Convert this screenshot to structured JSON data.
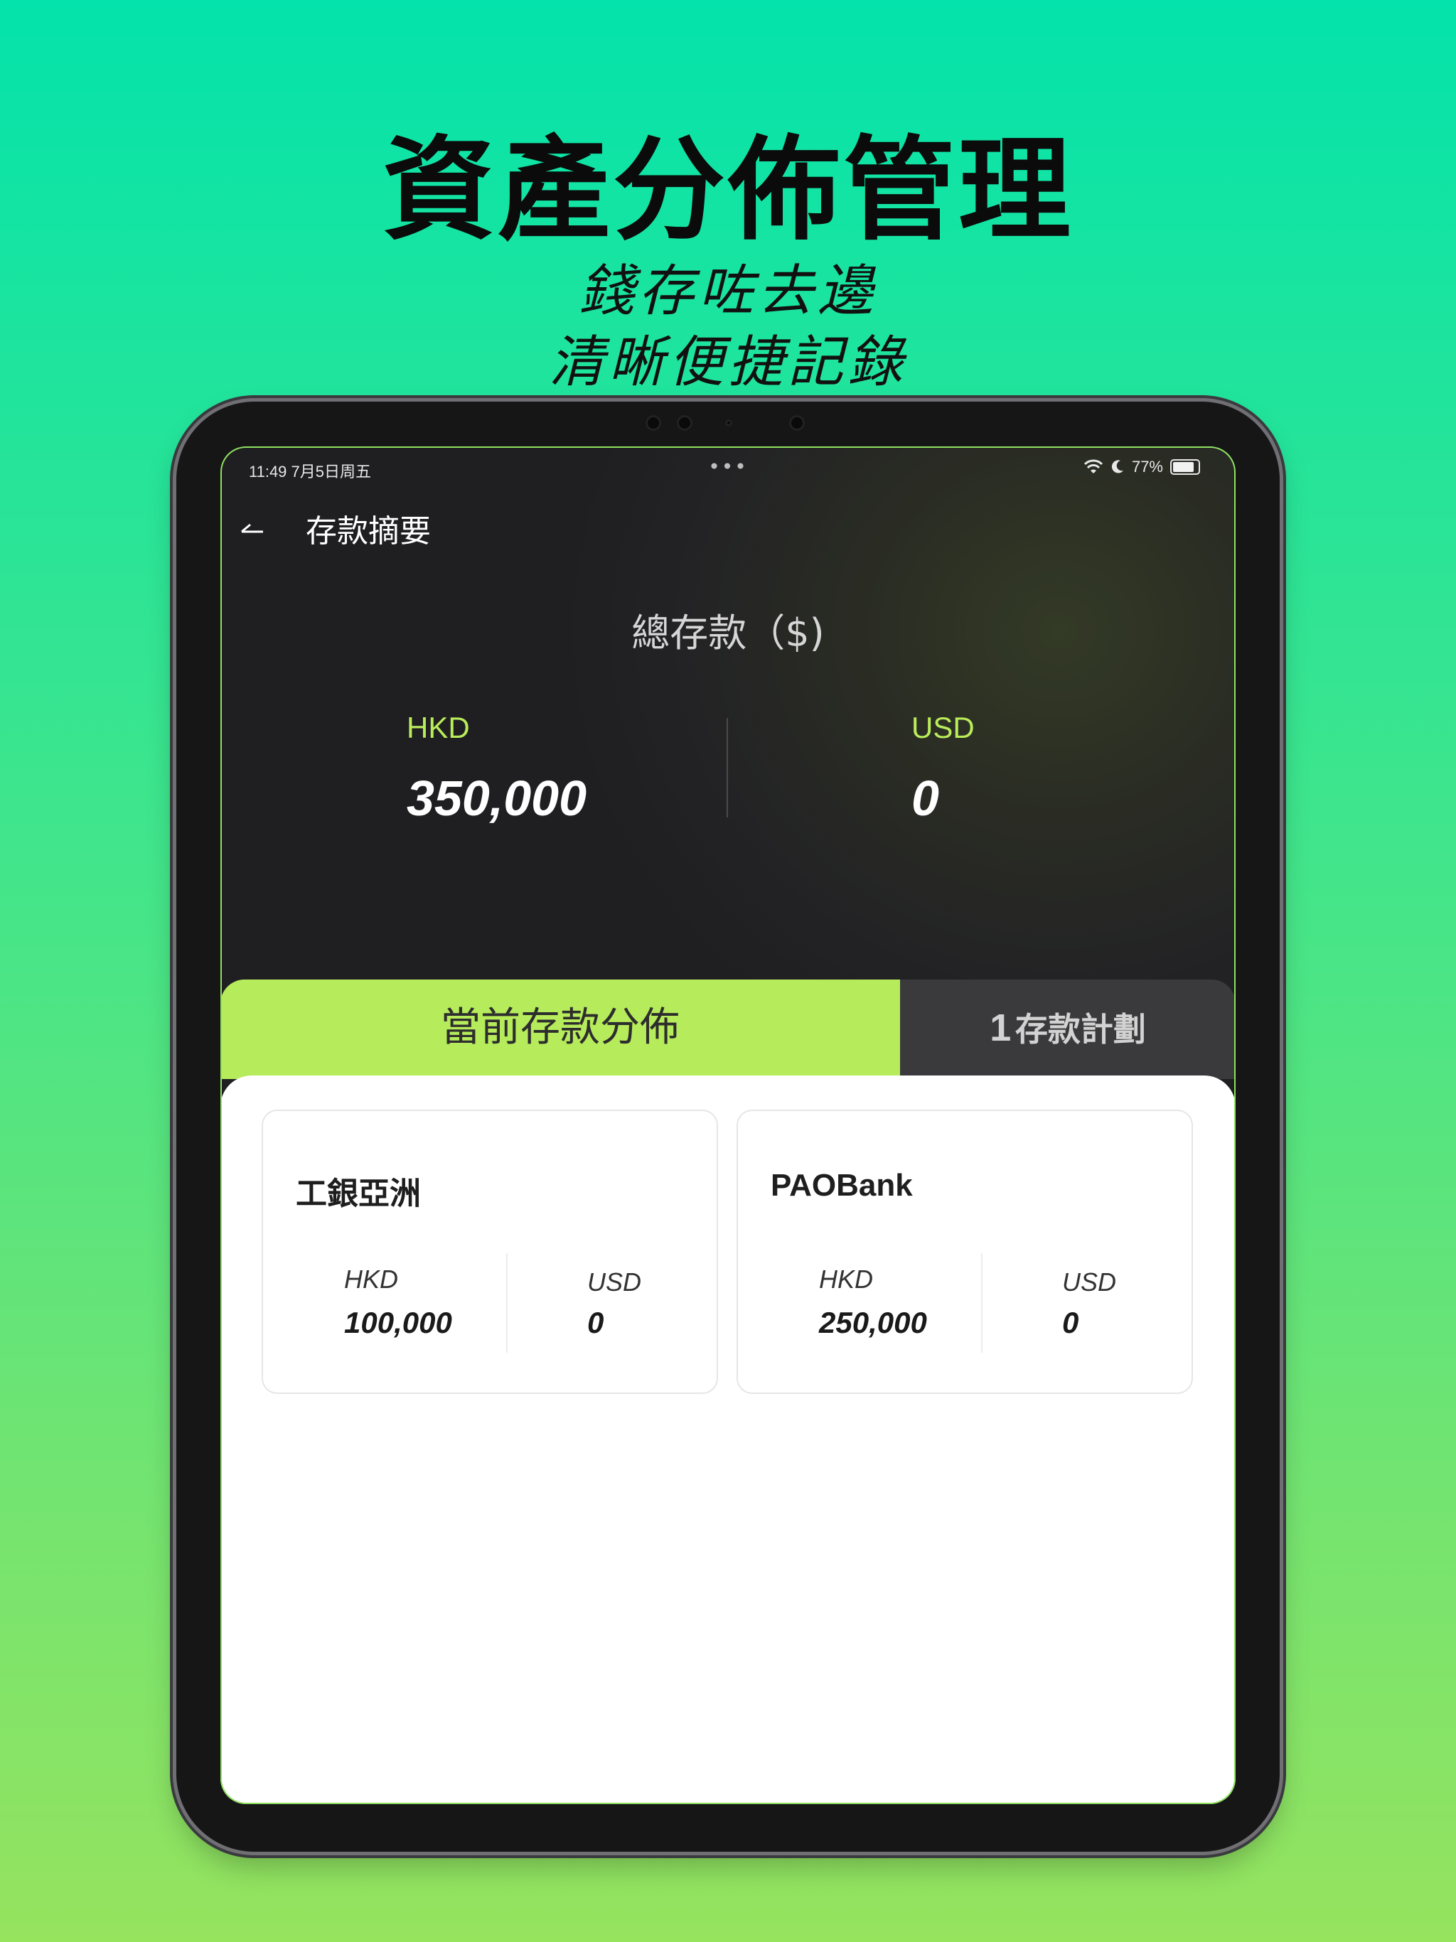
{
  "promo": {
    "title": "資產分佈管理",
    "subtitle_line1": "錢存咗去邊",
    "subtitle_line2": "清晰便捷記錄"
  },
  "status_bar": {
    "time": "11:49  7月5日周五",
    "dots": "•••",
    "battery": "77%"
  },
  "header": {
    "back_icon": "back-arrow-icon",
    "title": "存款摘要"
  },
  "summary": {
    "total_label": "總存款（$)",
    "hkd_label": "HKD",
    "hkd_value": "350,000",
    "usd_label": "USD",
    "usd_value": "0"
  },
  "tabs": [
    {
      "label": "當前存款分佈",
      "active": true
    },
    {
      "count": "1",
      "label": "存款計劃",
      "active": false
    }
  ],
  "banks": [
    {
      "name": "工銀亞洲",
      "hkd_label": "HKD",
      "hkd_value": "100,000",
      "usd_label": "USD",
      "usd_value": "0"
    },
    {
      "name": "PAOBank",
      "hkd_label": "HKD",
      "hkd_value": "250,000",
      "usd_label": "USD",
      "usd_value": "0"
    }
  ],
  "colors": {
    "accent_green": "#b6ec5b",
    "background_top": "#04e3ab",
    "background_bottom": "#96e35e"
  }
}
